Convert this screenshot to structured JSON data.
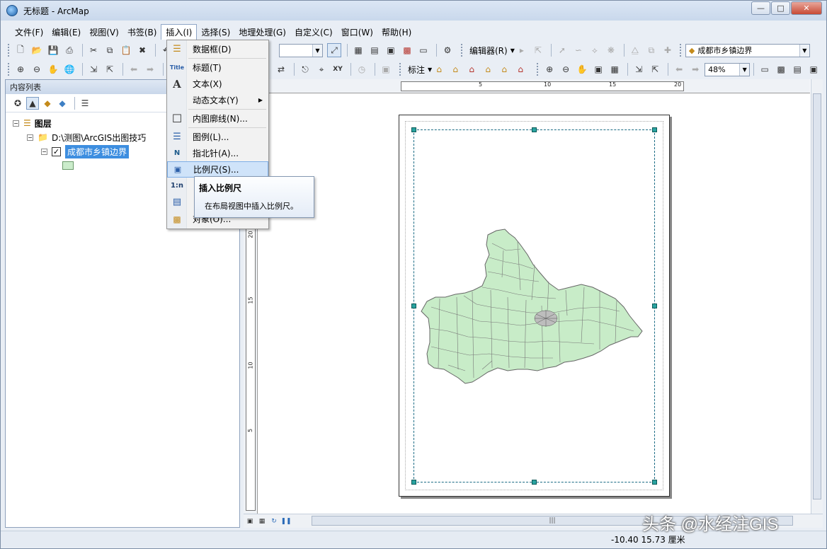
{
  "window": {
    "title": "无标题 - ArcMap"
  },
  "menubar": [
    "文件(F)",
    "编辑(E)",
    "视图(V)",
    "书签(B)",
    "插入(I)",
    "选择(S)",
    "地理处理(G)",
    "自定义(C)",
    "窗口(W)",
    "帮助(H)"
  ],
  "menubar_active": "插入(I)",
  "toolbar": {
    "editor_label": "编辑器(R)",
    "layer_combo": "成都市乡镇边界",
    "label_button": "标注",
    "zoom_combo": "48%"
  },
  "toc": {
    "title": "内容列表",
    "root": "图层",
    "folder": "D:\\测图\\ArcGIS出图技巧",
    "layer": "成都市乡镇边界",
    "layer_checked": "✓"
  },
  "insert_menu": {
    "items": [
      {
        "label": "数据框(D)",
        "icon": "data-frame-icon"
      },
      {
        "label": "标题(T)",
        "icon": "title-icon"
      },
      {
        "label": "文本(X)",
        "icon": "text-icon"
      },
      {
        "label": "动态文本(Y)",
        "icon": ""
      },
      {
        "label": "内图廓线(N)...",
        "icon": "neatline-icon"
      },
      {
        "label": "图例(L)...",
        "icon": "legend-icon"
      },
      {
        "label": "指北针(A)...",
        "icon": "north-arrow-icon"
      },
      {
        "label": "比例尺(S)...",
        "icon": "scale-bar-icon"
      },
      {
        "label": "对象(O)...",
        "icon": "object-icon"
      }
    ],
    "icon_glyphs": {
      "title": "Title",
      "text": "A",
      "north": "N",
      "scale_text": "1:n"
    }
  },
  "tooltip": {
    "title": "插入比例尺",
    "body": "在布局视图中插入比例尺。"
  },
  "ruler": {
    "h_ticks": [
      "5",
      "10",
      "15",
      "20"
    ],
    "v_ticks": [
      "20",
      "15",
      "10",
      "5"
    ]
  },
  "status": {
    "coordinates": "-10.40  15.73 厘米"
  },
  "watermark": "头条 @水经注GIS",
  "colors": {
    "polygon_fill": "#c8ecc8",
    "polygon_stroke": "#666666",
    "selection": "#3d8ee0",
    "frame_handle": "#2aa3a0"
  }
}
